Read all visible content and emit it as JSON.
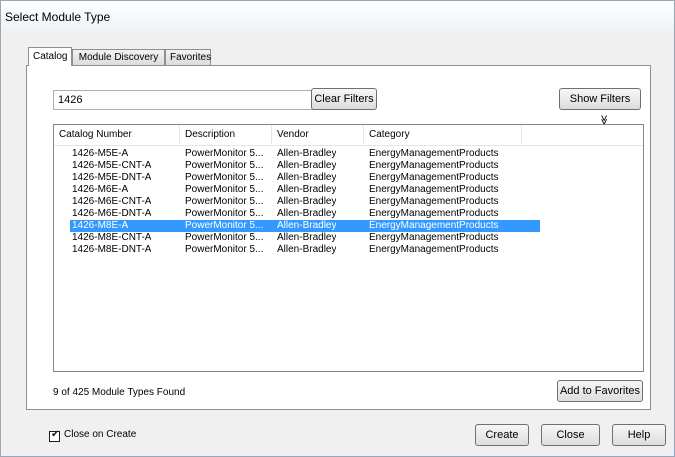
{
  "window": {
    "title": "Select Module Type"
  },
  "tabs": [
    {
      "label": "Catalog"
    },
    {
      "label": "Module Discovery"
    },
    {
      "label": "Favorites"
    }
  ],
  "search": {
    "value": "1426"
  },
  "buttons": {
    "clear_filters": "Clear Filters",
    "show_filters": "Show Filters",
    "show_filters_icon": "≫",
    "add_to_favorites": "Add to Favorites",
    "create": "Create",
    "close": "Close",
    "help": "Help"
  },
  "table": {
    "columns": [
      "Catalog Number",
      "Description",
      "Vendor",
      "Category"
    ],
    "rows": [
      [
        "1426-M5E-A",
        "PowerMonitor 5...",
        "Allen-Bradley",
        "EnergyManagementProducts"
      ],
      [
        "1426-M5E-CNT-A",
        "PowerMonitor 5...",
        "Allen-Bradley",
        "EnergyManagementProducts"
      ],
      [
        "1426-M5E-DNT-A",
        "PowerMonitor 5...",
        "Allen-Bradley",
        "EnergyManagementProducts"
      ],
      [
        "1426-M6E-A",
        "PowerMonitor 5...",
        "Allen-Bradley",
        "EnergyManagementProducts"
      ],
      [
        "1426-M6E-CNT-A",
        "PowerMonitor 5...",
        "Allen-Bradley",
        "EnergyManagementProducts"
      ],
      [
        "1426-M6E-DNT-A",
        "PowerMonitor 5...",
        "Allen-Bradley",
        "EnergyManagementProducts"
      ],
      [
        "1426-M8E-A",
        "PowerMonitor 5...",
        "Allen-Bradley",
        "EnergyManagementProducts"
      ],
      [
        "1426-M8E-CNT-A",
        "PowerMonitor 5...",
        "Allen-Bradley",
        "EnergyManagementProducts"
      ],
      [
        "1426-M8E-DNT-A",
        "PowerMonitor 5...",
        "Allen-Bradley",
        "EnergyManagementProducts"
      ]
    ],
    "selected_index": 6
  },
  "status": {
    "found_text": "9 of 425 Module Types Found"
  },
  "close_on_create": {
    "label": "Close on Create",
    "checked": true
  },
  "colors": {
    "selection": "#3399ff",
    "window_bg": "#f0f0f0"
  }
}
